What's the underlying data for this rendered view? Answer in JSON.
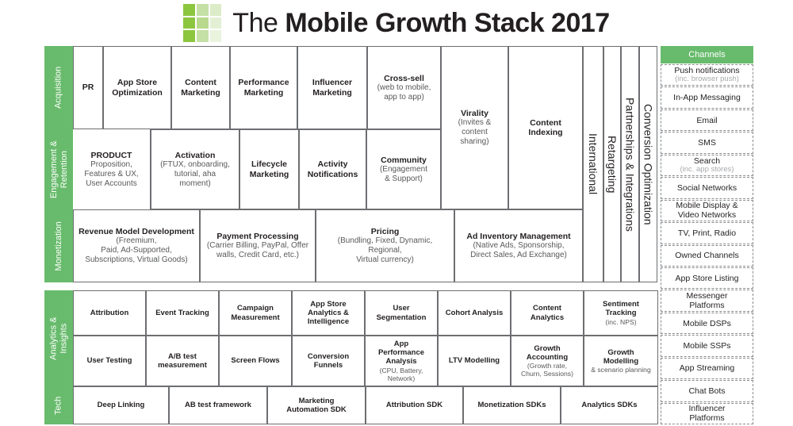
{
  "title": {
    "light": "The ",
    "bold": "Mobile Growth Stack 2017",
    "logo_colors": [
      "#8cc63f",
      "#c5e0a5",
      "#dcecc8",
      "#8cc63f",
      "#b9da8e",
      "#e4f0d5",
      "#8cc63f",
      "#c5e0a5",
      "#e9f3de"
    ]
  },
  "colors": {
    "green": "#68bb6c",
    "border": "#6d6e71",
    "dashed": "#8a8c8e",
    "subtext": "#58595b",
    "muted": "#a7a9ac"
  },
  "sections": {
    "acquisition": "Acquisition",
    "engagement": "Engagement &\nRetention",
    "monetization": "Monetization",
    "analytics": "Analytics &\nInsights",
    "tech": "Tech"
  },
  "acquisition_row": [
    {
      "t": "PR",
      "s": ""
    },
    {
      "t": "App Store\nOptimization",
      "s": ""
    },
    {
      "t": "Content\nMarketing",
      "s": ""
    },
    {
      "t": "Performance\nMarketing",
      "s": ""
    },
    {
      "t": "Influencer\nMarketing",
      "s": ""
    },
    {
      "t": "Cross-sell",
      "s": "(web to  mobile,\napp to app)"
    }
  ],
  "engagement_row": [
    {
      "t": "PRODUCT",
      "s": "Proposition,\nFeatures & UX,\nUser Accounts"
    },
    {
      "t": "Activation",
      "s": "(FTUX, onboarding,\ntutorial, aha\nmoment)"
    },
    {
      "t": "Lifecycle\nMarketing",
      "s": ""
    },
    {
      "t": "Activity\nNotifications",
      "s": ""
    },
    {
      "t": "Community",
      "s": "(Engagement\n& Support)"
    }
  ],
  "tall_cells": [
    {
      "t": "Virality",
      "s": "(Invites &\ncontent\nsharing)"
    },
    {
      "t": "Content\nIndexing",
      "s": ""
    }
  ],
  "monetization_row": [
    {
      "t": "Revenue Model Development",
      "s": "(Freemium,\nPaid, Ad-Supported,\nSubscriptions, Virtual Goods)"
    },
    {
      "t": "Payment Processing",
      "s": "(Carrier Billing, PayPal, Offer\nwalls, Credit Card, etc.)"
    },
    {
      "t": "Pricing",
      "s": "(Bundling, Fixed, Dynamic,\nRegional,\nVirtual currency)"
    },
    {
      "t": "Ad Inventory Management",
      "s": "(Native Ads, Sponsorship,\nDirect Sales, Ad Exchange)"
    }
  ],
  "vertical_columns": [
    "International",
    "Retargeting",
    "Partnerships & Integrations",
    "Conversion Optimization"
  ],
  "analytics_row_1": [
    {
      "t": "Attribution",
      "s": ""
    },
    {
      "t": "Event Tracking",
      "s": ""
    },
    {
      "t": "Campaign\nMeasurement",
      "s": ""
    },
    {
      "t": "App Store\nAnalytics &\nIntelligence",
      "s": ""
    },
    {
      "t": "User\nSegmentation",
      "s": ""
    },
    {
      "t": "Cohort Analysis",
      "s": ""
    },
    {
      "t": "Content\nAnalytics",
      "s": ""
    },
    {
      "t": "Sentiment\nTracking",
      "s": "(inc. NPS)"
    }
  ],
  "analytics_row_2": [
    {
      "t": "User Testing",
      "s": ""
    },
    {
      "t": "A/B test\nmeasurement",
      "s": ""
    },
    {
      "t": "Screen Flows",
      "s": ""
    },
    {
      "t": "Conversion\nFunnels",
      "s": ""
    },
    {
      "t": "App\nPerformance\nAnalysis",
      "s": "(CPU, Battery,\nNetwork)"
    },
    {
      "t": "LTV Modelling",
      "s": ""
    },
    {
      "t": "Growth\nAccounting",
      "s": "(Growth rate,\nChurn, Sessions)"
    },
    {
      "t": "Growth\nModelling",
      "s": "& scenario planning"
    }
  ],
  "tech_row": [
    {
      "t": "Deep Linking",
      "s": ""
    },
    {
      "t": "AB test framework",
      "s": ""
    },
    {
      "t": "Marketing\nAutomation SDK",
      "s": ""
    },
    {
      "t": "Attribution SDK",
      "s": ""
    },
    {
      "t": "Monetization SDKs",
      "s": ""
    },
    {
      "t": "Analytics SDKs",
      "s": ""
    }
  ],
  "channels": {
    "header": "Channels",
    "items": [
      {
        "t": "Push notifications",
        "s": "(inc. browser push)"
      },
      {
        "t": "In-App Messaging",
        "s": ""
      },
      {
        "t": "Email",
        "s": ""
      },
      {
        "t": "SMS",
        "s": ""
      },
      {
        "t": "Search",
        "s": "(inc. app stores)"
      },
      {
        "t": "Social Networks",
        "s": ""
      },
      {
        "t": "Mobile Display &\nVideo Networks",
        "s": ""
      },
      {
        "t": "TV, Print, Radio",
        "s": ""
      },
      {
        "t": "Owned Channels",
        "s": ""
      },
      {
        "t": "App Store Listing",
        "s": ""
      },
      {
        "t": "Messenger\nPlatforms",
        "s": ""
      },
      {
        "t": "Mobile DSPs",
        "s": ""
      },
      {
        "t": "Mobile SSPs",
        "s": ""
      },
      {
        "t": "App Streaming",
        "s": ""
      },
      {
        "t": "Chat Bots",
        "s": ""
      },
      {
        "t": "Influencer\nPlatforms",
        "s": ""
      }
    ]
  }
}
